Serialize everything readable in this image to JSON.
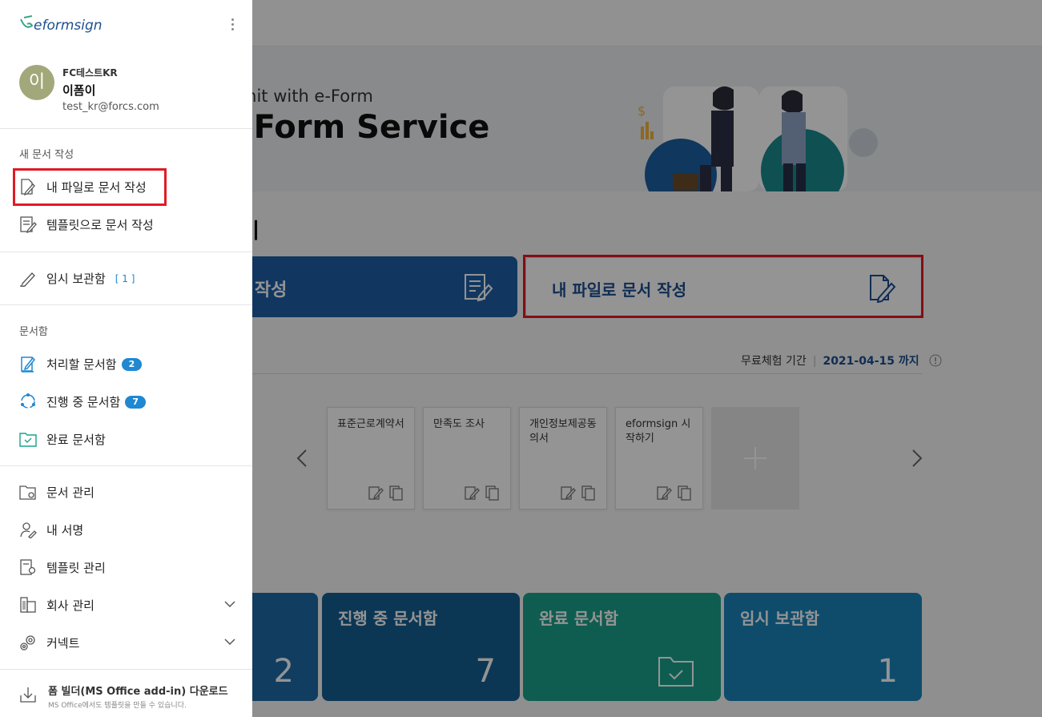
{
  "main": {
    "banner": {
      "subtitle": "mit with e-Form",
      "title": "-Form Service"
    },
    "section_title": "기",
    "template_card": {
      "label": "서 작성"
    },
    "my_file_card": {
      "label": "내 파일로 문서 작성"
    },
    "trial": {
      "label": "무료체험 기간",
      "date": "2021-04-15 까지",
      "info_icon": "info-icon"
    },
    "templates": [
      {
        "name": "표준근로계약서"
      },
      {
        "name": "만족도 조사"
      },
      {
        "name": "개인정보제공동의서"
      },
      {
        "name": "eformsign 시작하기"
      }
    ],
    "boxes": [
      {
        "label": "",
        "count": "2",
        "color": "#1e6aa8"
      },
      {
        "label": "진행 중 문서함",
        "count": "7",
        "color": "#155f92"
      },
      {
        "label": "완료 문서함",
        "count": "",
        "color": "#1aa18b"
      },
      {
        "label": "임시 보관함",
        "count": "1",
        "color": "#1b83ba"
      }
    ]
  },
  "panel": {
    "logo": "eformsign",
    "profile": {
      "avatar_char": "이",
      "company": "FC테스트KR",
      "name": "이폼이",
      "email": "test_kr@forcs.com"
    },
    "new_doc_section": "새 문서 작성",
    "new_my_file": "내 파일로 문서 작성",
    "new_template": "템플릿으로 문서 작성",
    "temp_storage": {
      "label": "임시 보관함",
      "count": "[ 1 ]"
    },
    "docbox_section": "문서함",
    "action_required": {
      "label": "처리할 문서함",
      "count": "2"
    },
    "in_progress": {
      "label": "진행 중 문서함",
      "count": "7"
    },
    "completed": "완료 문서함",
    "doc_manage": "문서 관리",
    "my_signature": "내 서명",
    "template_manage": "템플릿 관리",
    "company_manage": "회사 관리",
    "connect": "커넥트",
    "download": {
      "title": "폼 빌더(MS Office add-in) 다운로드",
      "subtitle": "MS Office에서도 템플릿을 만들 수 있습니다."
    }
  },
  "colors": {
    "accent_blue": "#1e88d2",
    "highlight_red": "#e01b24",
    "primary_navy": "#1d4f8f"
  }
}
